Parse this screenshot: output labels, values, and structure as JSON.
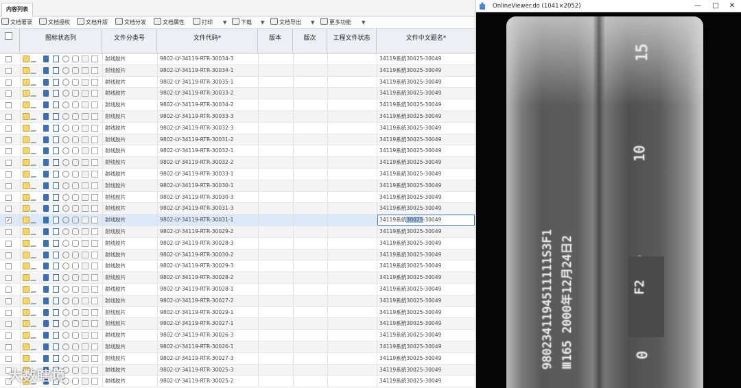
{
  "tab": {
    "label": "内容列表"
  },
  "toolbar": {
    "buttons": [
      {
        "label": "文档著录"
      },
      {
        "label": "文档授权"
      },
      {
        "label": "文档升版"
      },
      {
        "label": "文档分发"
      },
      {
        "label": "文档属性"
      },
      {
        "label": "打印"
      },
      {
        "label": "下载"
      },
      {
        "label": "文档导出"
      },
      {
        "label": "更多功能"
      }
    ]
  },
  "columns": [
    "图标状态列",
    "文件分类号",
    "文件代码*",
    "版本",
    "版次",
    "工程文件状态",
    "文件中文题名*"
  ],
  "rows": [
    {
      "category": "射线胶片",
      "code": "9802-LY-34119-RTR-30034-3",
      "title": "34119系统30025-30049"
    },
    {
      "category": "射线胶片",
      "code": "9802-LY-34119-RTR-30034-1",
      "title": "34119系统30025-30049"
    },
    {
      "category": "射线胶片",
      "code": "9802-LY-34119-RTR-30035-1",
      "title": "34119系统30025-30049"
    },
    {
      "category": "射线胶片",
      "code": "9802-LY-34119-RTR-30033-2",
      "title": "34119系统30025-30049"
    },
    {
      "category": "射线胶片",
      "code": "9802-LY-34119-RTR-30034-2",
      "title": "34119系统30025-30049"
    },
    {
      "category": "射线胶片",
      "code": "9802-LY-34119-RTR-30033-3",
      "title": "34119系统30025-30049"
    },
    {
      "category": "射线胶片",
      "code": "9802-LY-34119-RTR-30032-3",
      "title": "34119系统30025-30049"
    },
    {
      "category": "射线胶片",
      "code": "9802-LY-34119-RTR-30031-2",
      "title": "34119系统30025-30049"
    },
    {
      "category": "射线胶片",
      "code": "9802-LY-34119-RTR-30032-1",
      "title": "34119系统30025-30049"
    },
    {
      "category": "射线胶片",
      "code": "9802-LY-34119-RTR-30032-2",
      "title": "34119系统30025-30049"
    },
    {
      "category": "射线胶片",
      "code": "9802-LY-34119-RTR-30033-1",
      "title": "34119系统30025-30049"
    },
    {
      "category": "射线胶片",
      "code": "9802-LY-34119-RTR-30030-1",
      "title": "34119系统30025-30049"
    },
    {
      "category": "射线胶片",
      "code": "9802-LY-34119-RTR-30030-3",
      "title": "34119系统30025-30049"
    },
    {
      "category": "射线胶片",
      "code": "9802-LY-34119-RTR-30031-3",
      "title": "34119系统30025-30049"
    },
    {
      "category": "射线胶片",
      "code": "9802-LY-34119-RTR-30031-1",
      "title_pre": "34119系统",
      "title_hl": "30025",
      "title_post": "-30049",
      "selected": true
    },
    {
      "category": "射线胶片",
      "code": "9802-LY-34119-RTR-30029-2",
      "title": "34119系统30025-30049"
    },
    {
      "category": "射线胶片",
      "code": "9802-LY-34119-RTR-30028-3",
      "title": "34119系统30025-30049"
    },
    {
      "category": "射线胶片",
      "code": "9802-LY-34119-RTR-30030-2",
      "title": "34119系统30025-30049"
    },
    {
      "category": "射线胶片",
      "code": "9802-LY-34119-RTR-30029-3",
      "title": "34119系统30025-30049"
    },
    {
      "category": "射线胶片",
      "code": "9802-LY-34119-RTR-30028-2",
      "title": "34119系统30025-30049"
    },
    {
      "category": "射线胶片",
      "code": "9802-LY-34119-RTR-30028-1",
      "title": "34119系统30025-30049"
    },
    {
      "category": "射线胶片",
      "code": "9802-LY-34119-RTR-30027-2",
      "title": "34119系统30025-30049"
    },
    {
      "category": "射线胶片",
      "code": "9802-LY-34119-RTR-30029-1",
      "title": "34119系统30025-30049"
    },
    {
      "category": "射线胶片",
      "code": "9802-LY-34119-RTR-30027-1",
      "title": "34119系统30025-30049"
    },
    {
      "category": "射线胶片",
      "code": "9802-LY-34119-RTR-30026-3",
      "title": "34119系统30025-30049"
    },
    {
      "category": "射线胶片",
      "code": "9802-LY-34119-RTR-30026-1",
      "title": "34119系统30025-30049"
    },
    {
      "category": "射线胶片",
      "code": "9802-LY-34119-RTR-30027-3",
      "title": "34119系统30025-30049"
    },
    {
      "category": "射线胶片",
      "code": "9802-LY-34119-RTR-30025-3",
      "title": "34119系统30025-30049"
    },
    {
      "category": "射线胶片",
      "code": "9802-LY-34119-RTR-30025-2",
      "title": "34119系统30025-30049"
    }
  ],
  "viewer": {
    "title": "OnlineViewer.do",
    "dims": "(1041×2052)",
    "film_marks": [
      "15",
      "10",
      "5",
      "0"
    ],
    "film_id_line1": "9802341194511111S3F1",
    "film_id_line2": "Ⅲ165  2000年12月24日2",
    "film_marker": "F2"
  },
  "watermark": "大数瞎境"
}
